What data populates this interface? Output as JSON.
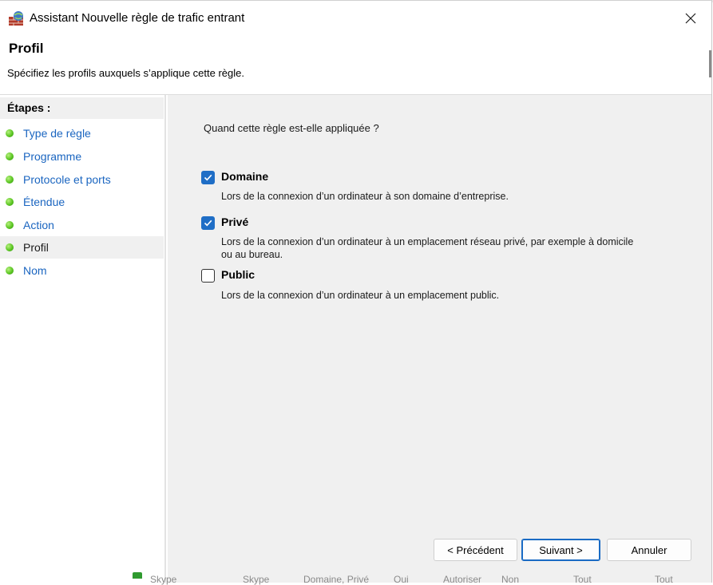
{
  "window": {
    "title": "Assistant Nouvelle règle de trafic entrant",
    "close_icon": "close-icon"
  },
  "header": {
    "title": "Profil",
    "subtitle": "Spécifiez les profils auxquels s’applique cette règle."
  },
  "steps": {
    "heading": "Étapes :",
    "items": [
      {
        "label": "Type de règle"
      },
      {
        "label": "Programme"
      },
      {
        "label": "Protocole et ports"
      },
      {
        "label": "Étendue"
      },
      {
        "label": "Action"
      },
      {
        "label": "Profil",
        "current": true
      },
      {
        "label": "Nom"
      }
    ]
  },
  "content": {
    "question": "Quand cette règle est-elle appliquée ?",
    "options": [
      {
        "label": "Domaine",
        "checked": true,
        "description": "Lors de la connexion d’un ordinateur à son domaine d’entreprise."
      },
      {
        "label": "Privé",
        "checked": true,
        "description": "Lors de la connexion d’un ordinateur à un emplacement réseau privé, par exemple à domicile ou au bureau."
      },
      {
        "label": "Public",
        "checked": false,
        "description": "Lors de la connexion d’un ordinateur à un emplacement public."
      }
    ]
  },
  "buttons": {
    "previous": "< Précédent",
    "next": "Suivant >",
    "cancel": "Annuler"
  },
  "background_table_fragments": [
    "Skype",
    "Skype",
    "Domaine, Privé",
    "Oui",
    "Autoriser",
    "Non",
    "Tout",
    "Tout"
  ],
  "colors": {
    "accent": "#1f6ec6",
    "link": "#1a65c0",
    "step_bullet": "#5cc623",
    "content_bg": "#f0f0f0"
  }
}
